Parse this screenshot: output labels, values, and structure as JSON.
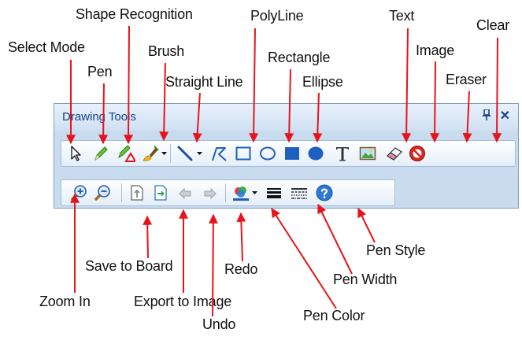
{
  "panel": {
    "title": "Drawing Tools",
    "pin_glyph": "ꟸ",
    "close_glyph": "✕"
  },
  "toolbar1": [
    {
      "icon": "select-cursor-icon",
      "label": "Select Mode"
    },
    {
      "icon": "pen-icon",
      "label": "Pen"
    },
    {
      "icon": "shape-recognition-icon",
      "label": "Shape Recognition"
    },
    {
      "icon": "brush-icon",
      "label": "Brush"
    },
    {
      "icon": "straight-line-icon",
      "label": "Straight Line"
    },
    {
      "icon": "polyline-icon",
      "label": "PolyLine"
    },
    {
      "icon": "rectangle-icon",
      "label": "Rectangle"
    },
    {
      "icon": "ellipse-icon",
      "label": "Ellipse"
    },
    {
      "icon": "filled-rectangle-icon",
      "label": ""
    },
    {
      "icon": "filled-ellipse-icon",
      "label": ""
    },
    {
      "icon": "text-icon",
      "label": "Text"
    },
    {
      "icon": "image-icon",
      "label": "Image"
    },
    {
      "icon": "eraser-icon",
      "label": "Eraser"
    },
    {
      "icon": "clear-icon",
      "label": "Clear"
    }
  ],
  "toolbar2": [
    {
      "icon": "zoom-in-icon",
      "label": "Zoom In"
    },
    {
      "icon": "zoom-out-icon",
      "label": ""
    },
    {
      "icon": "save-to-board-icon",
      "label": "Save to Board"
    },
    {
      "icon": "export-to-image-icon",
      "label": "Export to Image"
    },
    {
      "icon": "undo-icon",
      "label": "Undo"
    },
    {
      "icon": "redo-icon",
      "label": "Redo"
    },
    {
      "icon": "pen-color-icon",
      "label": "Pen Color"
    },
    {
      "icon": "pen-width-icon",
      "label": "Pen Width"
    },
    {
      "icon": "pen-style-icon",
      "label": "Pen Style"
    },
    {
      "icon": "help-icon",
      "label": ""
    }
  ],
  "callouts": {
    "shape_recognition": "Shape Recognition",
    "polyline": "PolyLine",
    "text": "Text",
    "clear": "Clear",
    "select_mode": "Select Mode",
    "brush": "Brush",
    "image": "Image",
    "rectangle": "Rectangle",
    "pen": "Pen",
    "straight_line": "Straight Line",
    "ellipse": "Ellipse",
    "eraser": "Eraser",
    "pen_style": "Pen Style",
    "save_to_board": "Save to Board",
    "redo": "Redo",
    "pen_width": "Pen Width",
    "zoom_in": "Zoom In",
    "export_to_image": "Export to Image",
    "undo": "Undo",
    "pen_color": "Pen Color"
  },
  "colors": {
    "arrow": "#e8141b",
    "panel_bg": "#c9dbef",
    "title_text": "#15428b",
    "icon_blue": "#1f5fbf"
  }
}
